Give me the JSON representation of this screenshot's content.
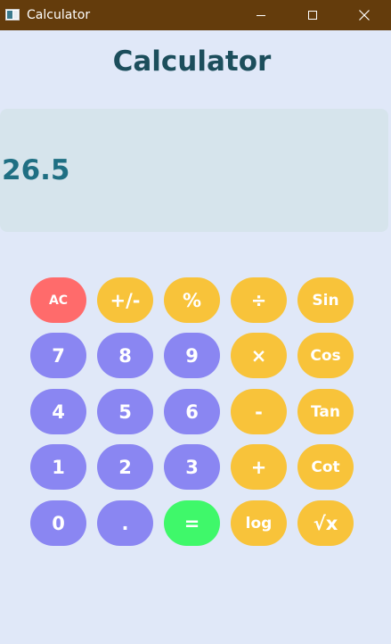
{
  "window": {
    "title": "Calculator"
  },
  "app": {
    "heading": "Calculator"
  },
  "display": {
    "value": "26.5"
  },
  "colors": {
    "titlebar": "#643c0c",
    "background": "#e0e8f8",
    "display": "#d6e4ec",
    "heading": "#1c4e5c",
    "display_text": "#1f6f83",
    "clear_key": "#ff6b6b",
    "operator_key": "#f8c33a",
    "digit_key": "#8a86f2",
    "equals_key": "#3ff86a"
  },
  "keypad": {
    "clear": "AC",
    "sign": "+/-",
    "percent": "%",
    "divide": "÷",
    "sin": "Sin",
    "seven": "7",
    "eight": "8",
    "nine": "9",
    "multiply": "×",
    "cos": "Cos",
    "four": "4",
    "five": "5",
    "six": "6",
    "subtract": "-",
    "tan": "Tan",
    "one": "1",
    "two": "2",
    "three": "3",
    "add": "+",
    "cot": "Cot",
    "zero": "0",
    "decimal": ".",
    "equals": "=",
    "log": "log",
    "sqrt": "√x"
  }
}
